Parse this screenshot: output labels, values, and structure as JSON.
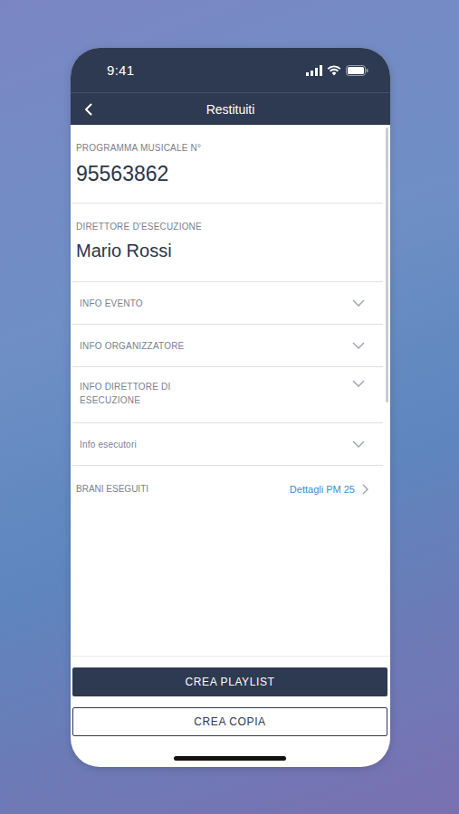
{
  "status_bar": {
    "time": "9:41"
  },
  "nav": {
    "title": "Restituiti"
  },
  "fields": [
    {
      "label": "PROGRAMMA MUSICALE N°",
      "value": "95563862",
      "kind": "number"
    },
    {
      "label": "DIRETTORE D'ESECUZIONE",
      "value": "Mario Rossi",
      "kind": "name"
    }
  ],
  "sections": [
    {
      "label": "INFO EVENTO",
      "expanded": false
    },
    {
      "label": "INFO ORGANIZZATORE",
      "expanded": false
    },
    {
      "label": "INFO DIRETTORE DI ESECUZIONE",
      "expanded": false
    },
    {
      "label": "Info esecutori",
      "expanded": false
    }
  ],
  "link_row": {
    "label": "BRANI ESEGUITI",
    "link": "Dettagli PM 25"
  },
  "buttons": [
    {
      "label": "CREA PLAYLIST",
      "kind": "primary"
    },
    {
      "label": "CREA COPIA",
      "kind": "secondary"
    }
  ]
}
